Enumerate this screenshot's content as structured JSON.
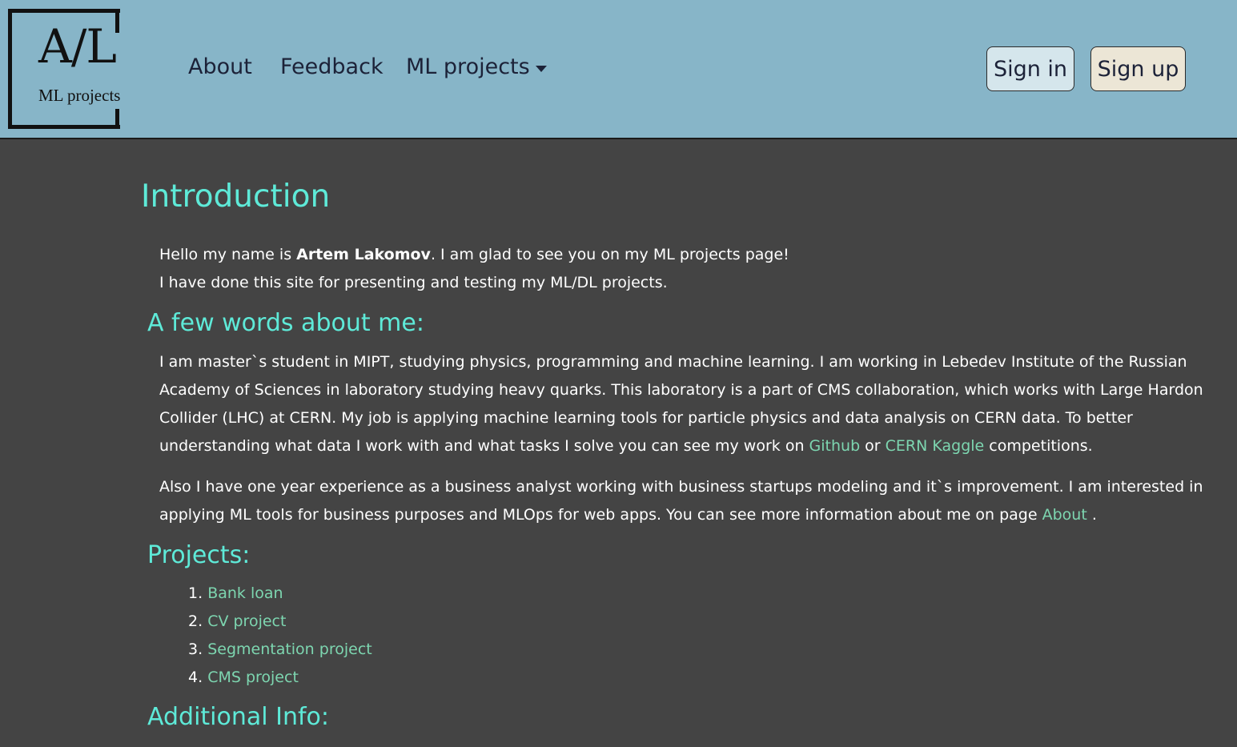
{
  "logo": {
    "big": "A/L",
    "small": "ML projects"
  },
  "nav": {
    "about": "About",
    "feedback": "Feedback",
    "ml_projects": "ML projects"
  },
  "auth": {
    "sign_in": "Sign in",
    "sign_up": "Sign up"
  },
  "intro": {
    "title": "Introduction",
    "hello_before": "Hello my name is ",
    "name": "Artem Lakomov",
    "hello_after": ". I am glad to see you on my ML projects page!",
    "line2": "I have done this site for presenting and testing my ML/DL projects."
  },
  "about_me": {
    "title": "A few words about me:",
    "p1_before": "I am master`s student in MIPT, studying physics, programming and machine learning. I am working in Lebedev Institute of the Russian Academy of Sciences in laboratory studying heavy quarks. This laboratory is a part of CMS collaboration, which works with Large Hardon Collider (LHC) at CERN. My job is applying machine learning tools for particle physics and data analysis on CERN data. To better understanding what data I work with and what tasks I solve you can see my work on ",
    "github_link": "Github",
    "p1_or": " or ",
    "kaggle_link": "CERN Kaggle",
    "p1_after": " competitions.",
    "p2_before": "Also I have one year experience as a business analyst working with business startups modeling and it`s improvement. I am interested in applying ML tools for business purposes and MLOps for web apps. You can see more information about me on page ",
    "about_link": "About",
    "p2_after": " ."
  },
  "projects": {
    "title": "Projects:",
    "items": [
      {
        "num": "1.",
        "label": "Bank loan"
      },
      {
        "num": "2.",
        "label": "CV project"
      },
      {
        "num": "3.",
        "label": "Segmentation project"
      },
      {
        "num": "4.",
        "label": "CMS project"
      }
    ]
  },
  "additional": {
    "title": "Additional Info:"
  },
  "colors": {
    "navbar_bg": "#87b5c8",
    "page_bg": "#444444",
    "heading": "#5eead8",
    "link": "#7dd6b0"
  }
}
